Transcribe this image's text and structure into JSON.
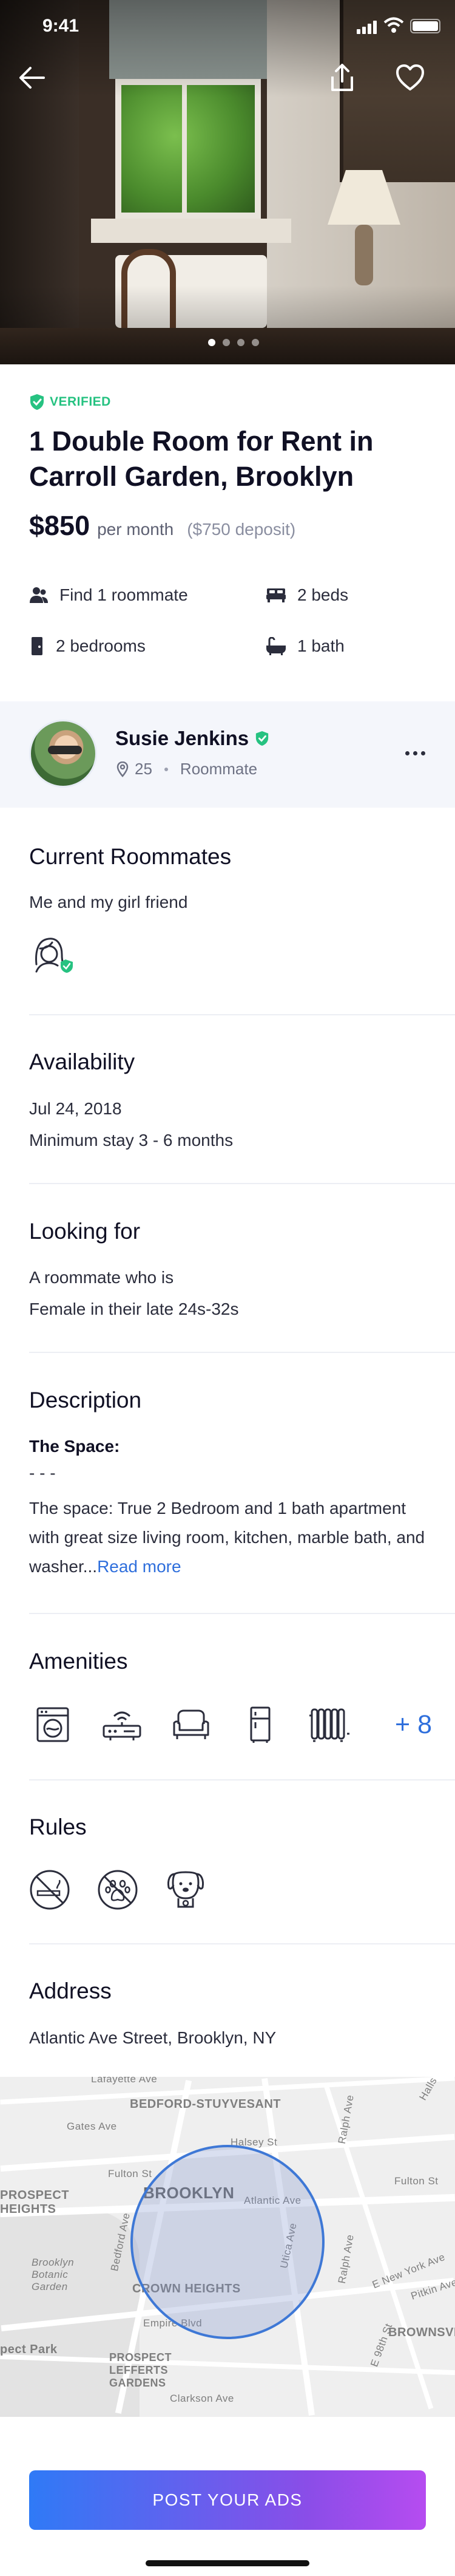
{
  "status_bar": {
    "time": "9:41"
  },
  "listing": {
    "verified_label": "VERIFIED",
    "title": "1 Double Room for Rent in Carroll Garden, Brooklyn",
    "price": "$850",
    "per_month": "per month",
    "deposit": "($750 deposit)",
    "facts": [
      {
        "icon": "people-icon",
        "label": "Find 1 roommate"
      },
      {
        "icon": "bed-icon",
        "label": "2 beds"
      },
      {
        "icon": "door-icon",
        "label": "2 bedrooms"
      },
      {
        "icon": "bath-icon",
        "label": "1 bath"
      }
    ]
  },
  "host": {
    "name": "Susie Jenkins",
    "age": "25",
    "role": "Roommate"
  },
  "roommates": {
    "title": "Current Roommates",
    "text": "Me and my girl friend"
  },
  "availability": {
    "title": "Availability",
    "date": "Jul 24, 2018",
    "stay": "Minimum stay 3 - 6 months"
  },
  "looking_for": {
    "title": "Looking for",
    "line1": "A roommate who is",
    "line2": "Female in their late 24s-32s"
  },
  "description": {
    "title": "Description",
    "subtitle": "The Space:",
    "separator": "- - -",
    "text": "The space: True 2 Bedroom and 1 bath apartment with great size living room, kitchen, marble bath, and washer...",
    "read_more": "Read more"
  },
  "amenities": {
    "title": "Amenities",
    "items": [
      "washer-icon",
      "router-icon",
      "armchair-icon",
      "fridge-icon",
      "radiator-icon"
    ],
    "more": "+ 8"
  },
  "rules": {
    "title": "Rules",
    "items": [
      "no-smoking-icon",
      "no-pets-icon",
      "dog-allowed-icon"
    ]
  },
  "address": {
    "title": "Address",
    "text": "Atlantic Ave Street, Brooklyn, NY"
  },
  "map": {
    "labels": {
      "lafayette": "Lafayette Ave",
      "bed_stuy": "BEDFORD-STUYVESANT",
      "gates": "Gates Ave",
      "halsey": "Halsey St",
      "fulton": "Fulton St",
      "ralph": "Ralph Ave",
      "prospect_heights": "PROSPECT HEIGHTS",
      "brooklyn": "BROOKLYN",
      "atlantic": "Atlantic Ave",
      "utica": "Utica Ave",
      "bedford": "Bedford Ave",
      "botanic": "Brooklyn Botanic Garden",
      "crown_heights": "CROWN HEIGHTS",
      "e_ny": "E New York Ave",
      "pitkin": "Pitkin Ave",
      "empire": "Empire Blvd",
      "brownsville": "BROWNSVI",
      "prospect_park": "pect Park",
      "lefferts": "PROSPECT LEFFERTS GARDENS",
      "clarkson": "Clarkson Ave",
      "e98": "E 98th St",
      "halls": "Halls"
    }
  },
  "cta": {
    "label": "POST YOUR ADS"
  },
  "colors": {
    "accent": "#2f6fdc",
    "verified": "#26c281",
    "gradient_start": "#2f7af6",
    "gradient_end": "#b64cf0"
  }
}
